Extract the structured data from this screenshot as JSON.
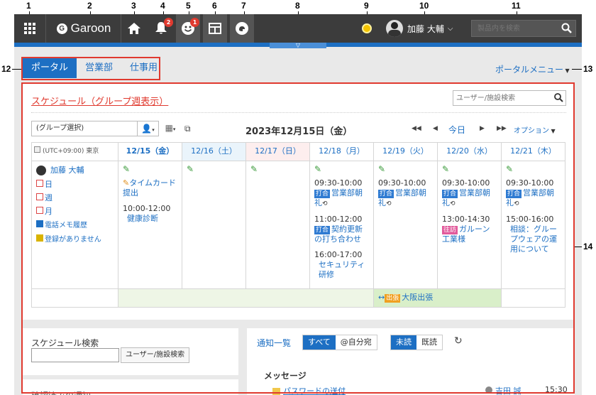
{
  "callouts": [
    "1",
    "2",
    "3",
    "4",
    "5",
    "6",
    "7",
    "8",
    "9",
    "10",
    "11",
    "12",
    "13",
    "14"
  ],
  "header": {
    "logo": "Garoon",
    "notification_badge": "2",
    "presence_badge": "1",
    "user_name": "加藤 大輔",
    "search_placeholder": "製品内を検索"
  },
  "portal_tabs": [
    {
      "label": "ポータル",
      "active": true
    },
    {
      "label": "営業部",
      "active": false
    },
    {
      "label": "仕事用",
      "active": false
    }
  ],
  "portal_menu": "ポータルメニュー",
  "schedule": {
    "title": "スケジュール（グループ週表示）",
    "facility_search_placeholder": "ユーザー/施設検索",
    "group_select": "(グループ選択)",
    "date_title": "2023年12月15日（金）",
    "today": "今日",
    "options": "オプション",
    "timezone": "(UTC+09:00) 東京",
    "days": [
      "12/15（金）",
      "12/16（土）",
      "12/17（日）",
      "12/18（月）",
      "12/19（火）",
      "12/20（水）",
      "12/21（木）"
    ],
    "user": "加藤 大輔",
    "user_links": [
      "日",
      "週",
      "月",
      "電話メモ履歴",
      "登録がありません"
    ],
    "day0": {
      "todo": "タイムカード提出",
      "time": "10:00-12:00",
      "title": "健康診断"
    },
    "day3": [
      {
        "time": "09:30-10:00",
        "tag": "打合",
        "title": "営業部朝礼"
      },
      {
        "time": "11:00-12:00",
        "tag": "打合",
        "title": "契約更新の打ち合わせ"
      },
      {
        "time": "16:00-17:00",
        "tag": "",
        "title": "セキュリティ研修"
      }
    ],
    "day4": [
      {
        "time": "09:30-10:00",
        "tag": "打合",
        "title": "営業部朝礼"
      }
    ],
    "day5": [
      {
        "time": "09:30-10:00",
        "tag": "打合",
        "title": "営業部朝礼"
      },
      {
        "time": "13:00-14:30",
        "tag": "往訪",
        "title": "ガルーン工業様"
      }
    ],
    "day6": [
      {
        "time": "09:30-10:00",
        "tag": "打合",
        "title": "営業部朝礼"
      },
      {
        "time": "15:00-16:00",
        "tag": "",
        "title": "相談：グループウェアの運用について"
      }
    ],
    "banner_tag": "出張",
    "banner_title": "大阪出張"
  },
  "search_panel": {
    "title": "スケジュール検索",
    "button": "ユーザー/施設検索",
    "below": "確認済みの通知"
  },
  "notify": {
    "title": "通知一覧",
    "all": "すべて",
    "to_me": "@自分宛",
    "unread": "未読",
    "read": "既読",
    "section": "メッセージ",
    "item": "パスワードの送付",
    "sender": "吉田 誠",
    "time": "15:30"
  },
  "colors": {
    "accent": "#1d6fc3",
    "header": "#3c3c3c",
    "callout_box": "#e03a2f",
    "sat": "#eaf4fb",
    "sun": "#fdeeee",
    "meeting": "#2f7bd2",
    "visit": "#e25a9b",
    "trip": "#f0a020"
  }
}
